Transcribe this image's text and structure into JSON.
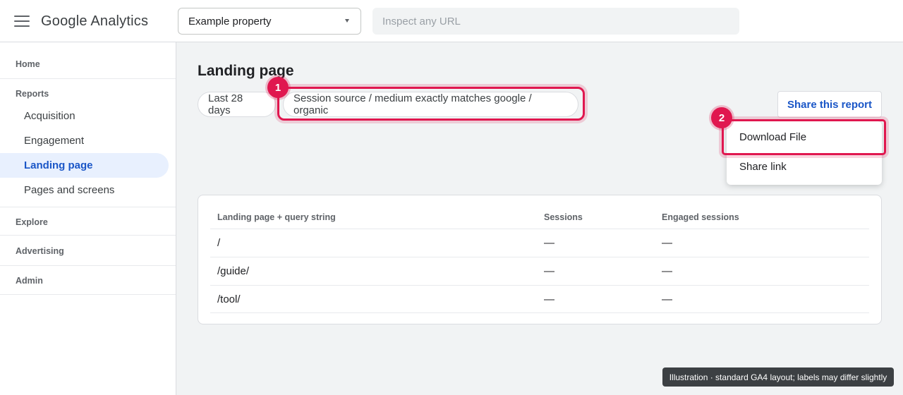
{
  "header": {
    "app_title": "Google Analytics",
    "property_select_value": "Example property",
    "url_search_placeholder": "Inspect any URL"
  },
  "sidebar": {
    "home": "Home",
    "reports_section": "Reports",
    "items": [
      {
        "label": "Acquisition",
        "active": false
      },
      {
        "label": "Engagement",
        "active": false
      },
      {
        "label": "Landing page",
        "active": true
      },
      {
        "label": "Pages and screens",
        "active": false
      }
    ],
    "explore": "Explore",
    "advertising": "Advertising",
    "admin": "Admin"
  },
  "main": {
    "page_title": "Landing page",
    "date_range_chip": "Last 28 days",
    "filter_chip": "Session source / medium exactly matches google / organic",
    "share_button": "Share this report",
    "share_menu": {
      "download_file": "Download File",
      "share_link": "Share link"
    },
    "table": {
      "columns": [
        "Landing page + query string",
        "Sessions",
        "Engaged sessions"
      ],
      "rows": [
        [
          "/",
          "—",
          "—"
        ],
        [
          "/guide/",
          "—",
          "—"
        ],
        [
          "/tool/",
          "—",
          "—"
        ]
      ]
    }
  },
  "annotations": {
    "step_1": "1",
    "step_2": "2",
    "highlight_color": "#e0174f"
  },
  "caption": "Illustration · standard GA4 layout; labels may differ slightly",
  "colors": {
    "accent_blue": "#1a56c7",
    "active_nav_bg": "#e8f0fe"
  }
}
